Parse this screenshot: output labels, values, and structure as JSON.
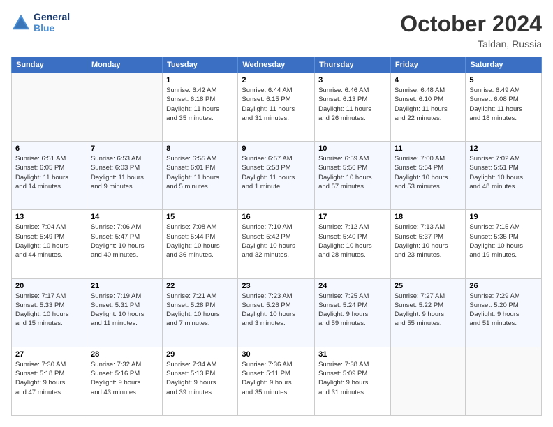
{
  "logo": {
    "line1": "General",
    "line2": "Blue"
  },
  "title": "October 2024",
  "location": "Taldan, Russia",
  "days_of_week": [
    "Sunday",
    "Monday",
    "Tuesday",
    "Wednesday",
    "Thursday",
    "Friday",
    "Saturday"
  ],
  "weeks": [
    [
      {
        "day": "",
        "detail": ""
      },
      {
        "day": "",
        "detail": ""
      },
      {
        "day": "1",
        "detail": "Sunrise: 6:42 AM\nSunset: 6:18 PM\nDaylight: 11 hours\nand 35 minutes."
      },
      {
        "day": "2",
        "detail": "Sunrise: 6:44 AM\nSunset: 6:15 PM\nDaylight: 11 hours\nand 31 minutes."
      },
      {
        "day": "3",
        "detail": "Sunrise: 6:46 AM\nSunset: 6:13 PM\nDaylight: 11 hours\nand 26 minutes."
      },
      {
        "day": "4",
        "detail": "Sunrise: 6:48 AM\nSunset: 6:10 PM\nDaylight: 11 hours\nand 22 minutes."
      },
      {
        "day": "5",
        "detail": "Sunrise: 6:49 AM\nSunset: 6:08 PM\nDaylight: 11 hours\nand 18 minutes."
      }
    ],
    [
      {
        "day": "6",
        "detail": "Sunrise: 6:51 AM\nSunset: 6:05 PM\nDaylight: 11 hours\nand 14 minutes."
      },
      {
        "day": "7",
        "detail": "Sunrise: 6:53 AM\nSunset: 6:03 PM\nDaylight: 11 hours\nand 9 minutes."
      },
      {
        "day": "8",
        "detail": "Sunrise: 6:55 AM\nSunset: 6:01 PM\nDaylight: 11 hours\nand 5 minutes."
      },
      {
        "day": "9",
        "detail": "Sunrise: 6:57 AM\nSunset: 5:58 PM\nDaylight: 11 hours\nand 1 minute."
      },
      {
        "day": "10",
        "detail": "Sunrise: 6:59 AM\nSunset: 5:56 PM\nDaylight: 10 hours\nand 57 minutes."
      },
      {
        "day": "11",
        "detail": "Sunrise: 7:00 AM\nSunset: 5:54 PM\nDaylight: 10 hours\nand 53 minutes."
      },
      {
        "day": "12",
        "detail": "Sunrise: 7:02 AM\nSunset: 5:51 PM\nDaylight: 10 hours\nand 48 minutes."
      }
    ],
    [
      {
        "day": "13",
        "detail": "Sunrise: 7:04 AM\nSunset: 5:49 PM\nDaylight: 10 hours\nand 44 minutes."
      },
      {
        "day": "14",
        "detail": "Sunrise: 7:06 AM\nSunset: 5:47 PM\nDaylight: 10 hours\nand 40 minutes."
      },
      {
        "day": "15",
        "detail": "Sunrise: 7:08 AM\nSunset: 5:44 PM\nDaylight: 10 hours\nand 36 minutes."
      },
      {
        "day": "16",
        "detail": "Sunrise: 7:10 AM\nSunset: 5:42 PM\nDaylight: 10 hours\nand 32 minutes."
      },
      {
        "day": "17",
        "detail": "Sunrise: 7:12 AM\nSunset: 5:40 PM\nDaylight: 10 hours\nand 28 minutes."
      },
      {
        "day": "18",
        "detail": "Sunrise: 7:13 AM\nSunset: 5:37 PM\nDaylight: 10 hours\nand 23 minutes."
      },
      {
        "day": "19",
        "detail": "Sunrise: 7:15 AM\nSunset: 5:35 PM\nDaylight: 10 hours\nand 19 minutes."
      }
    ],
    [
      {
        "day": "20",
        "detail": "Sunrise: 7:17 AM\nSunset: 5:33 PM\nDaylight: 10 hours\nand 15 minutes."
      },
      {
        "day": "21",
        "detail": "Sunrise: 7:19 AM\nSunset: 5:31 PM\nDaylight: 10 hours\nand 11 minutes."
      },
      {
        "day": "22",
        "detail": "Sunrise: 7:21 AM\nSunset: 5:28 PM\nDaylight: 10 hours\nand 7 minutes."
      },
      {
        "day": "23",
        "detail": "Sunrise: 7:23 AM\nSunset: 5:26 PM\nDaylight: 10 hours\nand 3 minutes."
      },
      {
        "day": "24",
        "detail": "Sunrise: 7:25 AM\nSunset: 5:24 PM\nDaylight: 9 hours\nand 59 minutes."
      },
      {
        "day": "25",
        "detail": "Sunrise: 7:27 AM\nSunset: 5:22 PM\nDaylight: 9 hours\nand 55 minutes."
      },
      {
        "day": "26",
        "detail": "Sunrise: 7:29 AM\nSunset: 5:20 PM\nDaylight: 9 hours\nand 51 minutes."
      }
    ],
    [
      {
        "day": "27",
        "detail": "Sunrise: 7:30 AM\nSunset: 5:18 PM\nDaylight: 9 hours\nand 47 minutes."
      },
      {
        "day": "28",
        "detail": "Sunrise: 7:32 AM\nSunset: 5:16 PM\nDaylight: 9 hours\nand 43 minutes."
      },
      {
        "day": "29",
        "detail": "Sunrise: 7:34 AM\nSunset: 5:13 PM\nDaylight: 9 hours\nand 39 minutes."
      },
      {
        "day": "30",
        "detail": "Sunrise: 7:36 AM\nSunset: 5:11 PM\nDaylight: 9 hours\nand 35 minutes."
      },
      {
        "day": "31",
        "detail": "Sunrise: 7:38 AM\nSunset: 5:09 PM\nDaylight: 9 hours\nand 31 minutes."
      },
      {
        "day": "",
        "detail": ""
      },
      {
        "day": "",
        "detail": ""
      }
    ]
  ]
}
